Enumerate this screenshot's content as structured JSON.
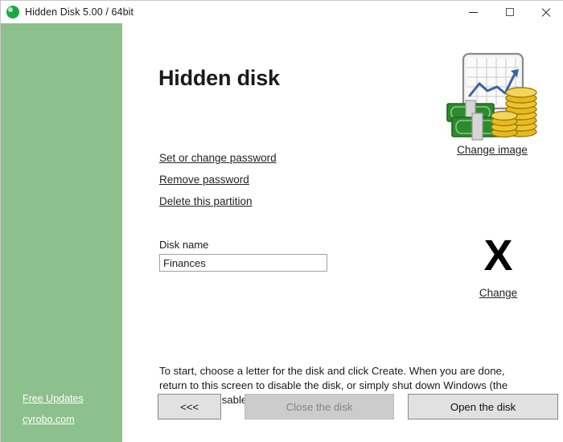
{
  "window": {
    "title": "Hidden Disk 5.00 / 64bit",
    "app_icon": "green-disk-icon",
    "controls": {
      "minimize": "minimize-icon",
      "maximize": "maximize-icon",
      "close": "close-icon"
    }
  },
  "sidebar": {
    "color": "#8cc08c",
    "links": [
      {
        "label": "Free Updates",
        "name": "free-updates-link"
      },
      {
        "label": "cyrobo.com",
        "name": "website-link"
      }
    ]
  },
  "main": {
    "page_title": "Hidden disk",
    "action_links": [
      {
        "label": "Set or change password",
        "name": "set-or-change-password-link"
      },
      {
        "label": "Remove password",
        "name": "remove-password-link"
      },
      {
        "label": "Delete this partition",
        "name": "delete-this-partition-link"
      }
    ],
    "disk_name": {
      "label": "Disk name",
      "value": "Finances",
      "placeholder": "Disk name"
    },
    "image_block": {
      "icon": "finance-chart-money-coins-icon",
      "change_label": "Change image"
    },
    "drive_letter_block": {
      "letter": "X",
      "change_label": "Change"
    },
    "instructions": "To start, choose a letter for the disk and click Create. When you are done, return to this screen to disable the disk, or simply shut down Windows (the disk will be disabled automatically).",
    "buttons": {
      "back": "<<<",
      "close_disk": "Close the disk",
      "open_disk": "Open the disk"
    }
  }
}
